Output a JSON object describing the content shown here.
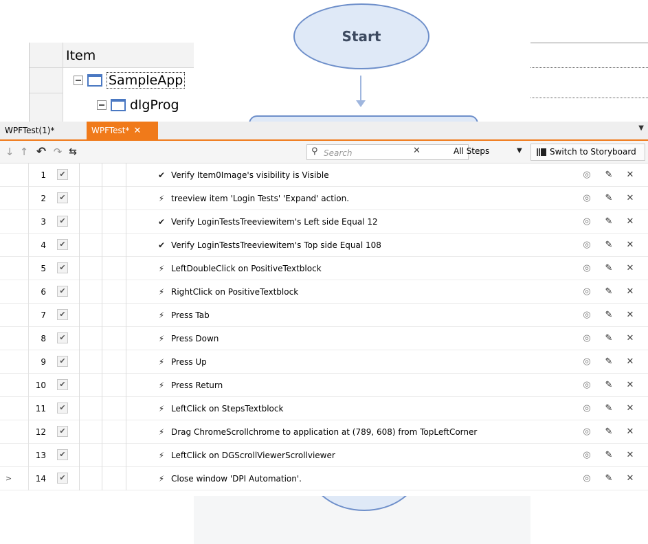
{
  "background": {
    "tree": {
      "header": "Item",
      "nodes": [
        {
          "label": "SampleApp"
        },
        {
          "label": "dlgProg"
        }
      ]
    },
    "flowchart": {
      "start_label": "Start"
    }
  },
  "tabs": [
    {
      "label": "WPFTest(1)*",
      "active": false
    },
    {
      "label": "WPFTest*",
      "active": true,
      "close_icon": "close-icon"
    }
  ],
  "tab_menu_icon": "dropdown-arrow-icon",
  "toolbar": {
    "icons": [
      "move-down-icon",
      "move-up-icon",
      "undo-icon",
      "redo-icon",
      "run-to-icon"
    ],
    "search": {
      "placeholder": "Search",
      "value": ""
    },
    "clear_label": "✕",
    "filter_label": "All Steps",
    "storyboard_label": "Switch to Storyboard"
  },
  "colors": {
    "accent": "#f07a1a",
    "flow_fill": "#dfe9f7",
    "flow_border": "#6e8fca"
  },
  "steps": [
    {
      "num": "1",
      "checked": true,
      "type": "verify",
      "icon": "✔",
      "text": "Verify Item0Image's visibility is Visible"
    },
    {
      "num": "2",
      "checked": true,
      "type": "action",
      "icon": "⚡",
      "text": "treeview item 'Login Tests' 'Expand' action."
    },
    {
      "num": "3",
      "checked": true,
      "type": "verify",
      "icon": "✔",
      "text": "Verify LoginTestsTreeviewitem's Left side Equal 12"
    },
    {
      "num": "4",
      "checked": true,
      "type": "verify",
      "icon": "✔",
      "text": "Verify LoginTestsTreeviewitem's Top side Equal 108"
    },
    {
      "num": "5",
      "checked": true,
      "type": "action",
      "icon": "⚡",
      "text": "LeftDoubleClick on PositiveTextblock"
    },
    {
      "num": "6",
      "checked": true,
      "type": "action",
      "icon": "⚡",
      "text": "RightClick on PositiveTextblock"
    },
    {
      "num": "7",
      "checked": true,
      "type": "action",
      "icon": "⚡",
      "text": "Press Tab"
    },
    {
      "num": "8",
      "checked": true,
      "type": "action",
      "icon": "⚡",
      "text": "Press Down"
    },
    {
      "num": "9",
      "checked": true,
      "type": "action",
      "icon": "⚡",
      "text": "Press Up"
    },
    {
      "num": "10",
      "checked": true,
      "type": "action",
      "icon": "⚡",
      "text": "Press Return"
    },
    {
      "num": "11",
      "checked": true,
      "type": "action",
      "icon": "⚡",
      "text": "LeftClick on StepsTextblock"
    },
    {
      "num": "12",
      "checked": true,
      "type": "action",
      "icon": "⚡",
      "text": "Drag ChromeScrollchrome to application at (789, 608) from TopLeftCorner"
    },
    {
      "num": "13",
      "checked": true,
      "type": "action",
      "icon": "⚡",
      "text": "LeftClick on DGScrollViewerScrollviewer"
    },
    {
      "num": "14",
      "checked": true,
      "type": "action",
      "icon": "⚡",
      "text": "Close window 'DPI Automation'.",
      "current": true,
      "marker": ">"
    }
  ]
}
